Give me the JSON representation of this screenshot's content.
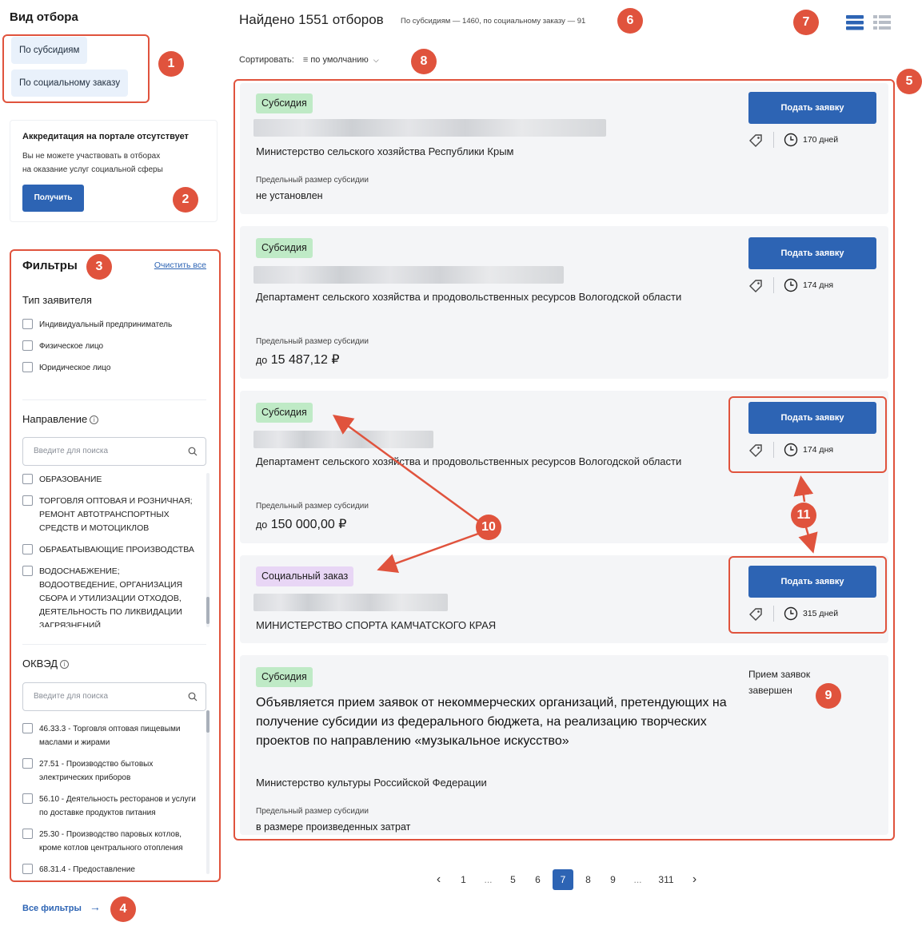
{
  "sidebar": {
    "title": "Вид отбора",
    "view_options": [
      "По субсидиям",
      "По социальному заказу"
    ],
    "accreditation": {
      "title": "Аккредитация на портале отсутствует",
      "text_line1": "Вы не можете участвовать в отборах",
      "text_line2": "на оказание услуг социальной сферы",
      "button": "Получить"
    },
    "filters": {
      "title": "Фильтры",
      "clear": "Очистить все",
      "applicant_type": {
        "title": "Тип заявителя",
        "options": [
          "Индивидуальный предприниматель",
          "Физическое лицо",
          "Юридическое лицо"
        ]
      },
      "direction": {
        "title": "Направление",
        "placeholder": "Введите для поиска",
        "options": [
          "ОБРАЗОВАНИЕ",
          "ТОРГОВЛЯ ОПТОВАЯ И РОЗНИЧНАЯ; РЕМОНТ АВТОТРАНСПОРТНЫХ СРЕДСТВ И МОТОЦИКЛОВ",
          "ОБРАБАТЫВАЮЩИЕ ПРОИЗВОДСТВА",
          "ВОДОСНАБЖЕНИЕ; ВОДООТВЕДЕНИЕ, ОРГАНИЗАЦИЯ СБОРА И УТИЛИЗАЦИИ ОТХОДОВ, ДЕЯТЕЛЬНОСТЬ ПО ЛИКВИДАЦИИ ЗАГРЯЗНЕНИЙ"
        ]
      },
      "okved": {
        "title": "ОКВЭД",
        "placeholder": "Введите для поиска",
        "options": [
          "46.33.3 - Торговля оптовая пищевыми маслами и жирами",
          "27.51 - Производство бытовых электрических приборов",
          "56.10 - Деятельность ресторанов и услуги по доставке продуктов питания",
          "25.30 - Производство паровых котлов, кроме котлов центрального отопления",
          "68.31.4 - Предоставление"
        ]
      }
    },
    "all_filters": "Все фильтры"
  },
  "header": {
    "found": "Найдено 1551 отборов",
    "found_sub": "По субсидиям — 1460, по социальному заказу — 91",
    "sort_label": "Сортировать:",
    "sort_value": "по умолчанию"
  },
  "cards": [
    {
      "tag": "Субсидия",
      "org": "Министерство сельского хозяйства Республики Крым",
      "limit_label": "Предельный размер субсидии",
      "limit_value": "не установлен",
      "apply": "Подать заявку",
      "days": "170 дней"
    },
    {
      "tag": "Субсидия",
      "org": "Департамент сельского хозяйства и продовольственных ресурсов Вологодской области",
      "limit_label": "Предельный размер субсидии",
      "limit_prefix": "до",
      "limit_value": "15 487,12 ₽",
      "apply": "Подать заявку",
      "days": "174 дня"
    },
    {
      "tag": "Субсидия",
      "org": "Департамент сельского хозяйства и продовольственных ресурсов Вологодской области",
      "limit_label": "Предельный размер субсидии",
      "limit_prefix": "до",
      "limit_value": "150 000,00 ₽",
      "apply": "Подать заявку",
      "days": "174 дня"
    },
    {
      "tag": "Социальный заказ",
      "org": "МИНИСТЕРСТВО СПОРТА КАМЧАТСКОГО КРАЯ",
      "apply": "Подать заявку",
      "days": "315 дней"
    },
    {
      "tag": "Субсидия",
      "title": "Объявляется прием заявок от некоммерческих организаций, претендующих на получение субсидии из федерального бюджета, на реализацию творческих проектов по направлению «музыкальное искусство»",
      "org": "Министерство культуры Российской Федерации",
      "limit_label": "Предельный размер субсидии",
      "limit_value": "в размере произведенных затрат",
      "status": "Прием заявок завершен"
    }
  ],
  "pagination": [
    "‹",
    "1",
    "...",
    "5",
    "6",
    "7",
    "8",
    "9",
    "...",
    "311",
    "›"
  ],
  "pagination_active": "7",
  "annotations": [
    "1",
    "2",
    "3",
    "4",
    "5",
    "6",
    "7",
    "8",
    "9",
    "10",
    "11"
  ],
  "colors": {
    "accent": "#2d64b4",
    "annotation": "#e0533d",
    "tag_subsidy": "#bfeac6",
    "tag_social": "#e8d6f5",
    "card_bg": "#f4f5f7"
  }
}
